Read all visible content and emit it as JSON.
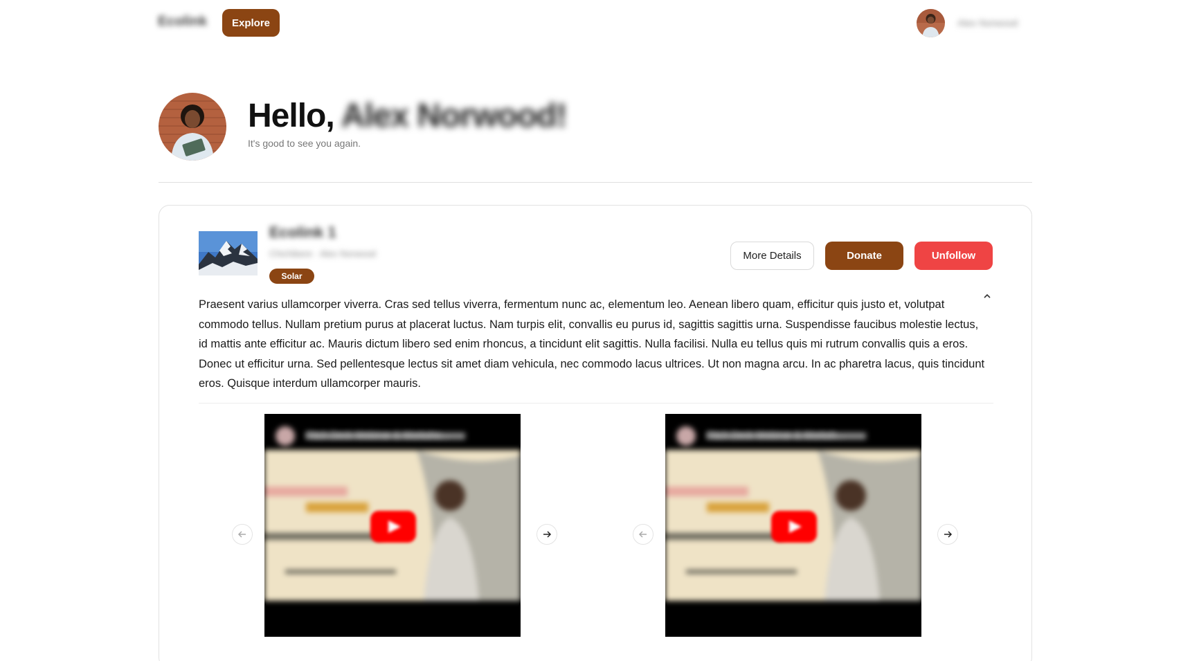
{
  "header": {
    "logo": "Ecolink",
    "explore_label": "Explore",
    "username": "Alex Norwood"
  },
  "greeting": {
    "hello": "Hello,",
    "name": "Alex Norwood!",
    "subtitle": "It's good to see you again."
  },
  "project": {
    "title": "Ecolink 1",
    "meta": "Chichibere · Alex Norwood",
    "tag": "Solar",
    "buttons": {
      "details": "More Details",
      "donate": "Donate",
      "unfollow": "Unfollow"
    },
    "description": "Praesent varius ullamcorper viverra. Cras sed tellus viverra, fermentum nunc ac, elementum leo. Aenean libero quam, efficitur quis justo et, volutpat commodo tellus. Nullam pretium purus at placerat luctus. Nam turpis elit, convallis eu purus id, sagittis sagittis urna. Suspendisse faucibus molestie lectus, id mattis ante efficitur ac. Mauris dictum libero sed enim rhoncus, a tincidunt elit sagittis. Nulla facilisi. Nulla eu tellus quis mi rutrum convallis quis a eros. Donec ut efficitur urna. Sed pellentesque lectus sit amet diam vehicula, nec commodo lacus ultrices. Ut non magna arcu. In ac pharetra lacus, quis tincidunt eros. Quisque interdum ullamcorper mauris.",
    "videos": [
      {
        "title": "Pitch Deck Webinar & Worksho..."
      },
      {
        "title": "Pitch Deck Webinar & Worksh..."
      }
    ]
  },
  "icons": {
    "collapse": "chevron-up-icon",
    "prev": "arrow-left-icon",
    "next": "arrow-right-icon",
    "play": "youtube-play-icon"
  },
  "colors": {
    "brand": "#8b4513",
    "danger": "#ef4444",
    "youtube": "#ff0000"
  }
}
